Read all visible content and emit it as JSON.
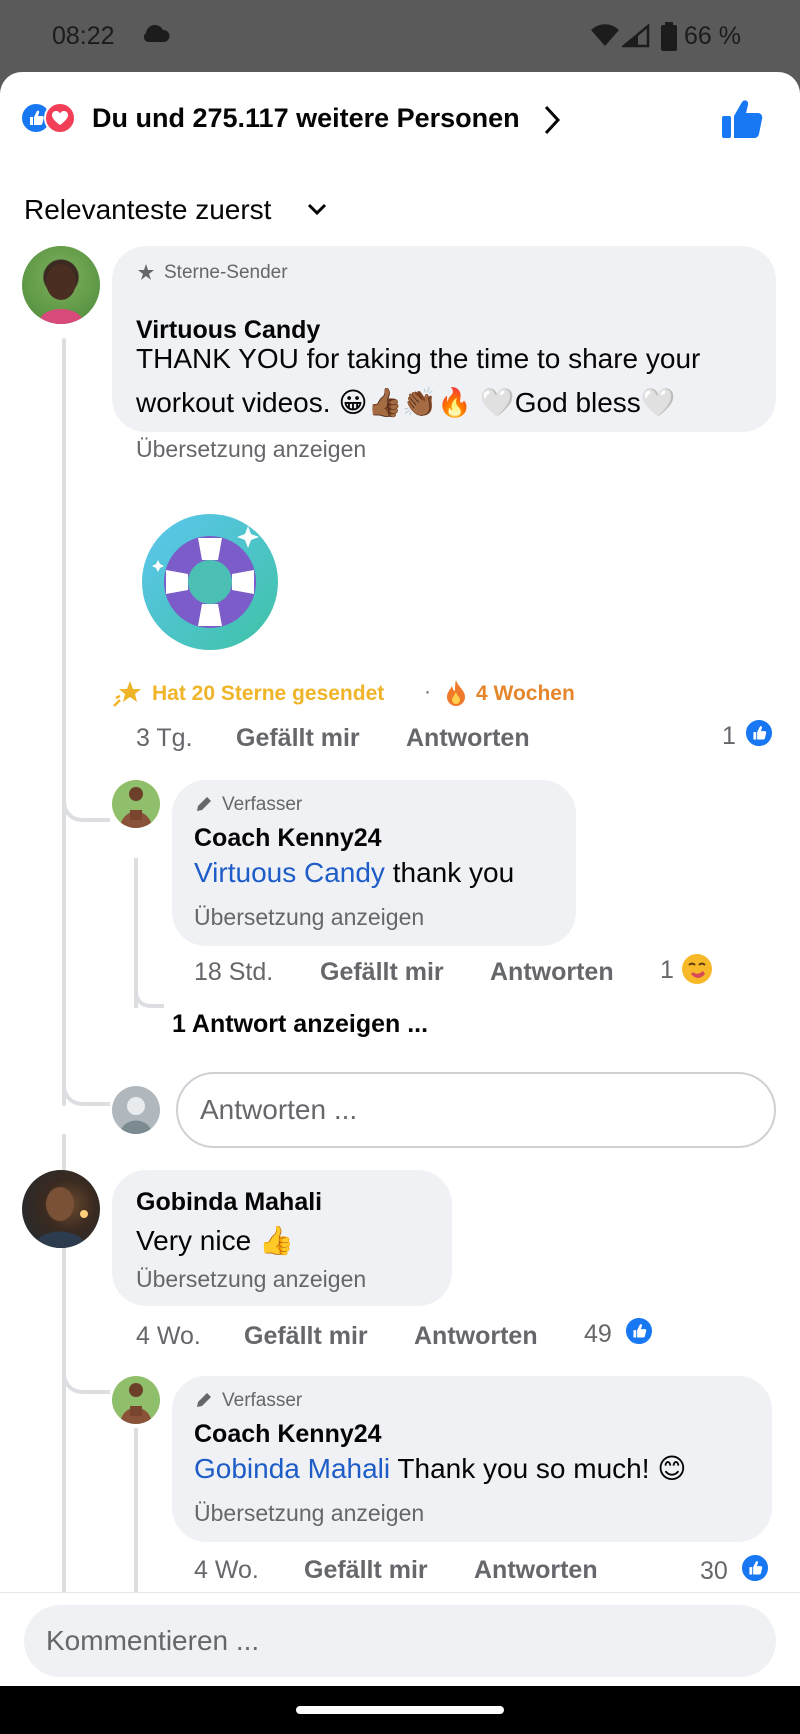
{
  "status_bar": {
    "time": "08:22",
    "battery": "66 %"
  },
  "header": {
    "reactions_text": "Du und 275.117 weitere Personen"
  },
  "sort": {
    "label": "Relevanteste zuerst"
  },
  "comments": [
    {
      "badge": "Sterne-Sender",
      "author": "Virtuous Candy",
      "text_line1": "THANK YOU for taking the time to share your",
      "text_line2": "workout videos. 😀👍🏾👏🏾🔥 🤍God bless🤍",
      "translate": "Übersetzung anzeigen",
      "stars_text": "Hat 20 Sterne gesendet",
      "separator": "·",
      "weeks_text": "4 Wochen",
      "time": "3 Tg.",
      "like_label": "Gefällt mir",
      "reply_label": "Antworten",
      "like_count": "1"
    },
    {
      "badge": "Verfasser",
      "author": "Coach Kenny24",
      "mention": "Virtuous Candy",
      "text": " thank you",
      "translate": "Übersetzung anzeigen",
      "time": "18 Std.",
      "like_label": "Gefällt mir",
      "reply_label": "Antworten",
      "like_count": "1",
      "more_replies": "1 Antwort anzeigen ..."
    },
    {
      "author": "Gobinda Mahali",
      "text": "Very nice 👍",
      "translate": "Übersetzung anzeigen",
      "time": "4 Wo.",
      "like_label": "Gefällt mir",
      "reply_label": "Antworten",
      "like_count": "49"
    },
    {
      "badge": "Verfasser",
      "author": "Coach Kenny24",
      "mention": "Gobinda Mahali",
      "text": " Thank you so much! 😊",
      "translate": "Übersetzung anzeigen",
      "time": "4 Wo.",
      "like_label": "Gefällt mir",
      "reply_label": "Antworten",
      "like_count": "30"
    }
  ],
  "reply_input": {
    "placeholder": "Antworten ..."
  },
  "comment_input": {
    "placeholder": "Kommentieren ..."
  },
  "colors": {
    "accent": "#1877f2",
    "mention": "#1e5cc7",
    "stars": "#f0b429",
    "love": "#f33e58"
  }
}
